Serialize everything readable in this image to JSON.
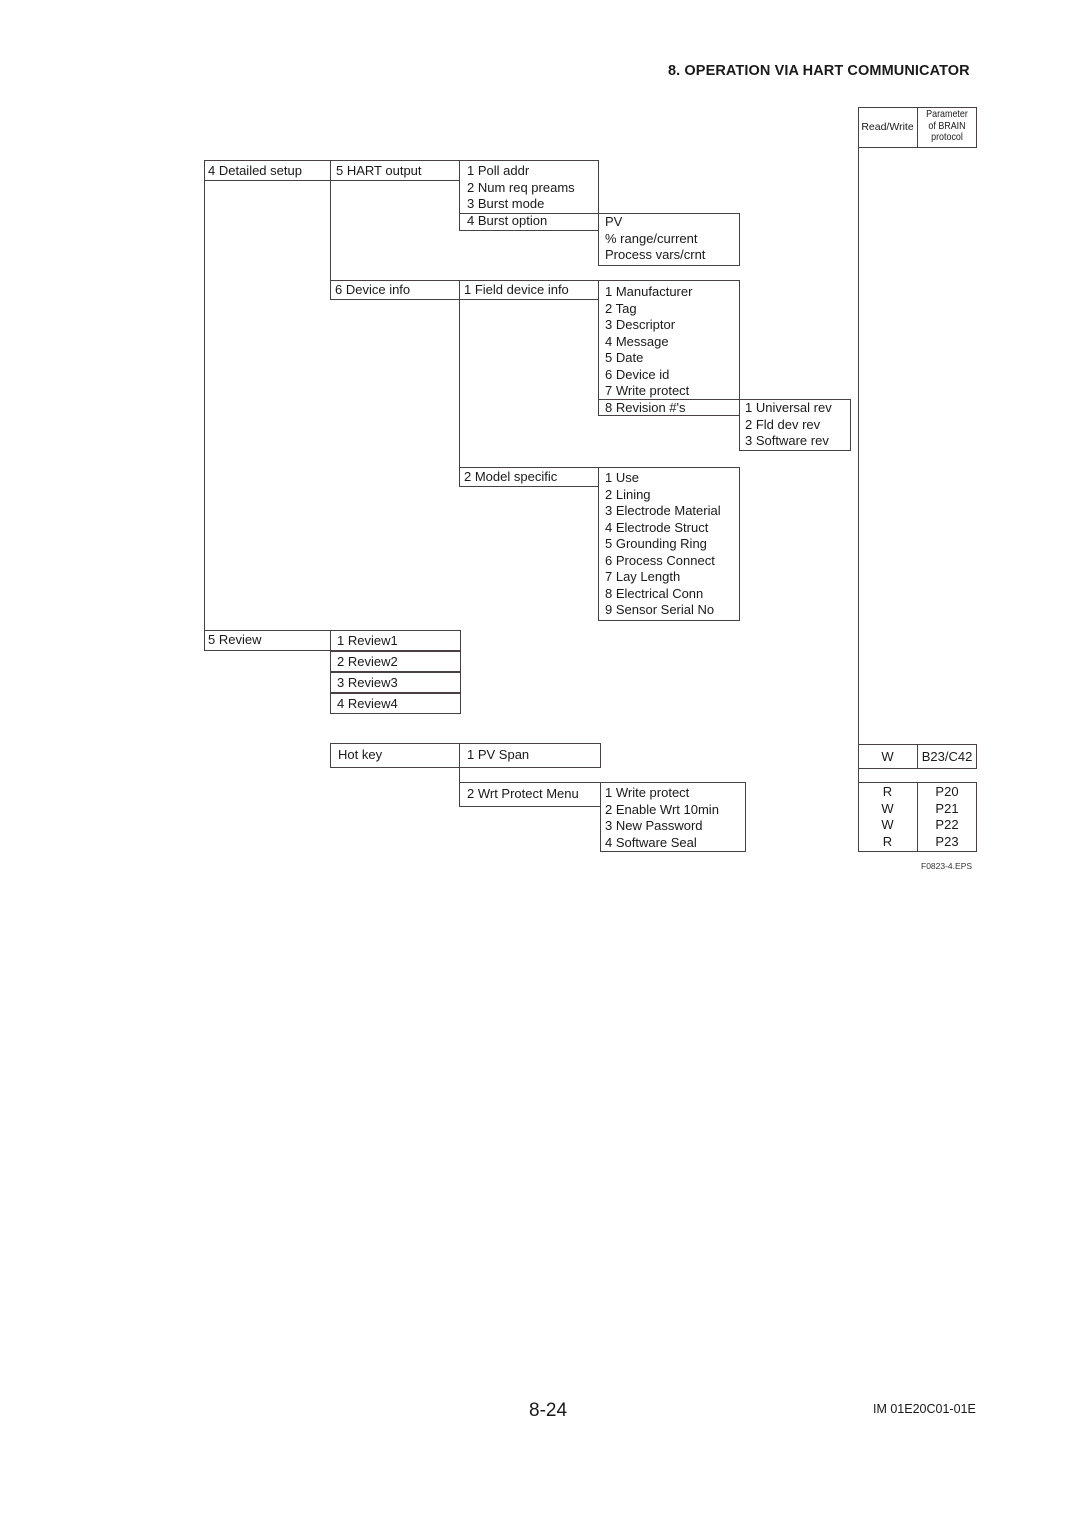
{
  "header": {
    "section_title": "8.  OPERATION VIA HART COMMUNICATOR"
  },
  "side_table": {
    "col_read_write": "Read/Write",
    "col_param": [
      "Parameter",
      "of BRAIN",
      "protocol"
    ],
    "pv_span_row": {
      "rw": "W",
      "param": "B23/C42"
    },
    "write_protect_rows": [
      {
        "rw": "R",
        "param": "P20"
      },
      {
        "rw": "W",
        "param": "P21"
      },
      {
        "rw": "W",
        "param": "P22"
      },
      {
        "rw": "R",
        "param": "P23"
      }
    ]
  },
  "menu": {
    "detailed_setup": "4 Detailed setup",
    "hart_output": "5 HART output",
    "hart_output_items": [
      "1 Poll addr",
      "2 Num req preams",
      "3 Burst mode"
    ],
    "burst_option": "4 Burst option",
    "burst_option_items": [
      "PV",
      "% range/current",
      "Process vars/crnt"
    ],
    "device_info": "6 Device info",
    "field_device_info": "1 Field device info",
    "field_device_items": [
      "1 Manufacturer",
      "2 Tag",
      "3 Descriptor",
      "4 Message",
      "5 Date",
      "6 Device id",
      "7 Write protect"
    ],
    "revision": "8 Revision #'s",
    "revision_items": [
      "1 Universal rev",
      "2 Fld dev rev",
      "3 Software rev"
    ],
    "model_specific": "2 Model specific",
    "model_specific_items": [
      "1 Use",
      "2 Lining",
      "3 Electrode Material",
      "4 Electrode Struct",
      "5 Grounding Ring",
      "6 Process Connect",
      "7 Lay Length",
      "8 Electrical Conn",
      "9 Sensor Serial No"
    ],
    "review": "5 Review",
    "review_items": [
      "1 Review1",
      "2 Review2",
      "3 Review3",
      "4 Review4"
    ],
    "hot_key": "Hot key",
    "pv_span": "1 PV Span",
    "wrt_protect_menu": "2 Wrt Protect Menu",
    "wrt_protect_items": [
      "1 Write protect",
      "2 Enable Wrt 10min",
      "3 New Password",
      "4 Software Seal"
    ]
  },
  "footer": {
    "figure_id": "F0823-4.EPS",
    "page_number": "8-24",
    "document_id": "IM 01E20C01-01E"
  }
}
